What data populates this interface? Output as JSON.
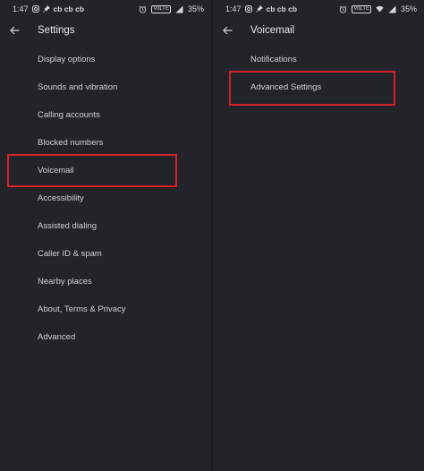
{
  "colors": {
    "background": "#232429",
    "text": "#cfcfd3",
    "highlight": "#d8202a"
  },
  "left_screen": {
    "status": {
      "time": "1:47",
      "carriers": "cb cb cb",
      "battery": "35%",
      "network_badge": "VoLTE"
    },
    "toolbar": {
      "title": "Settings"
    },
    "items": [
      {
        "label": "Display options"
      },
      {
        "label": "Sounds and vibration"
      },
      {
        "label": "Calling accounts"
      },
      {
        "label": "Blocked numbers"
      },
      {
        "label": "Voicemail"
      },
      {
        "label": "Accessibility"
      },
      {
        "label": "Assisted dialing"
      },
      {
        "label": "Caller ID & spam"
      },
      {
        "label": "Nearby places"
      },
      {
        "label": "About, Terms & Privacy"
      },
      {
        "label": "Advanced"
      }
    ],
    "highlighted_item": "Voicemail"
  },
  "right_screen": {
    "status": {
      "time": "1:47",
      "carriers": "cb cb cb",
      "battery": "35%",
      "network_badge": "VoLTE"
    },
    "toolbar": {
      "title": "Voicemail"
    },
    "items": [
      {
        "label": "Notifications"
      },
      {
        "label": "Advanced Settings"
      }
    ],
    "highlighted_item": "Advanced Settings"
  }
}
